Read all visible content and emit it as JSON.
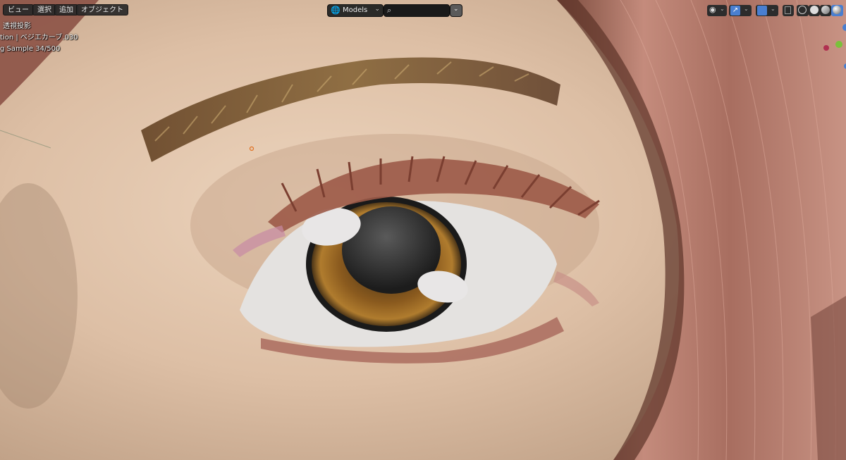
{
  "header": {
    "menus": [
      {
        "label": "ビュー"
      },
      {
        "label": "選択"
      },
      {
        "label": "追加"
      },
      {
        "label": "オブジェクト"
      }
    ],
    "collection_label": "Models",
    "search_placeholder": ""
  },
  "overlay": {
    "view_mode": "透視投影",
    "collection_object": "tion | ベジエカーブ.030",
    "render_status": "g Sample 34/500"
  },
  "colors": {
    "skin": "#dcbda3",
    "hair": "#b67a6c",
    "iris": "#8a5a1e",
    "accent_blue": "#4a7fd0"
  },
  "icons": {
    "collection": "globe-icon",
    "search": "search-icon",
    "filter": "chevron-down-icon",
    "visibility": "eye-icon",
    "gizmo": "transform-icon",
    "overlay": "overlay-icon",
    "xray": "xray-icon",
    "shading": [
      "wireframe-icon",
      "solid-icon",
      "material-icon",
      "rendered-icon"
    ]
  }
}
